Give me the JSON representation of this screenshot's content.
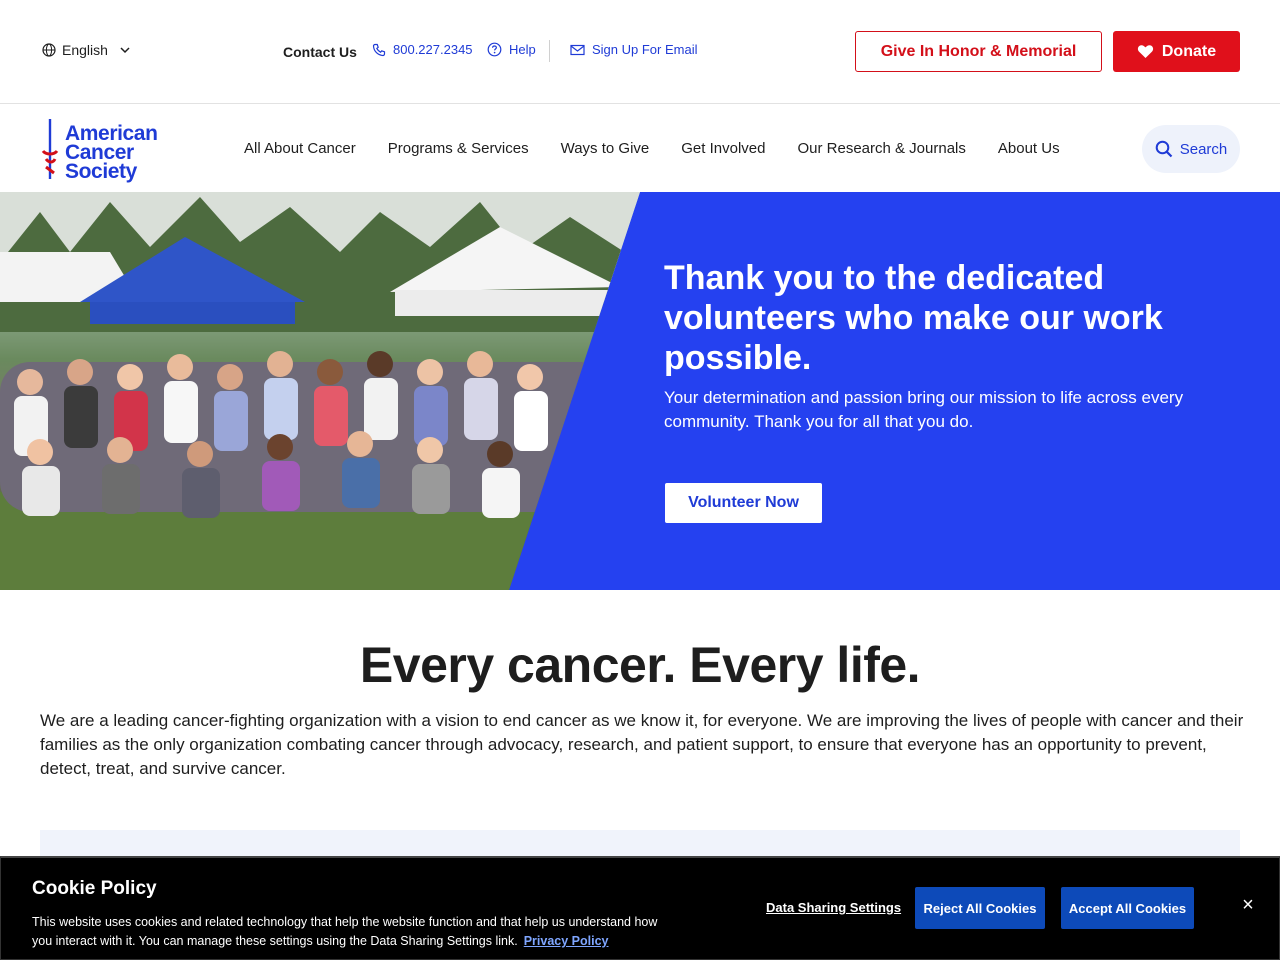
{
  "colors": {
    "brand_blue": "#1f3bd6",
    "hero_blue": "#2541f0",
    "donate_red": "#e0101b",
    "cookie_bg": "#000000",
    "cookie_button": "#0d4ab9"
  },
  "utility": {
    "language": "English",
    "contact_label": "Contact Us",
    "phone": "800.227.2345",
    "help": "Help",
    "email_signup": "Sign Up For Email",
    "honor_button": "Give In Honor & Memorial",
    "donate_button": "Donate"
  },
  "logo": {
    "line1": "American",
    "line2": "Cancer",
    "line3": "Society"
  },
  "nav": {
    "items": [
      "All About Cancer",
      "Programs & Services",
      "Ways to Give",
      "Get Involved",
      "Our Research & Journals",
      "About Us"
    ],
    "search": "Search"
  },
  "hero": {
    "title": "Thank you to the dedicated volunteers who make our work possible.",
    "subtitle": "Your determination and passion bring our mission to life across every community. Thank you for all that you do.",
    "button": "Volunteer Now"
  },
  "mission": {
    "title": "Every cancer. Every life.",
    "body": "We are a leading cancer-fighting organization with a vision to end cancer as we know it, for everyone. We are improving the lives of people with cancer and their families as the only organization combating cancer through advocacy, research, and patient support, to ensure that everyone has an opportunity to prevent, detect, treat, and survive cancer."
  },
  "cookie": {
    "title": "Cookie Policy",
    "text": "This website uses cookies and related technology that help the website function and that help us understand how you interact with it. You can manage these settings using the Data Sharing Settings link.",
    "privacy_link": "Privacy Policy",
    "data_settings": "Data Sharing Settings",
    "reject": "Reject All Cookies",
    "accept": "Accept All Cookies",
    "close": "×"
  }
}
